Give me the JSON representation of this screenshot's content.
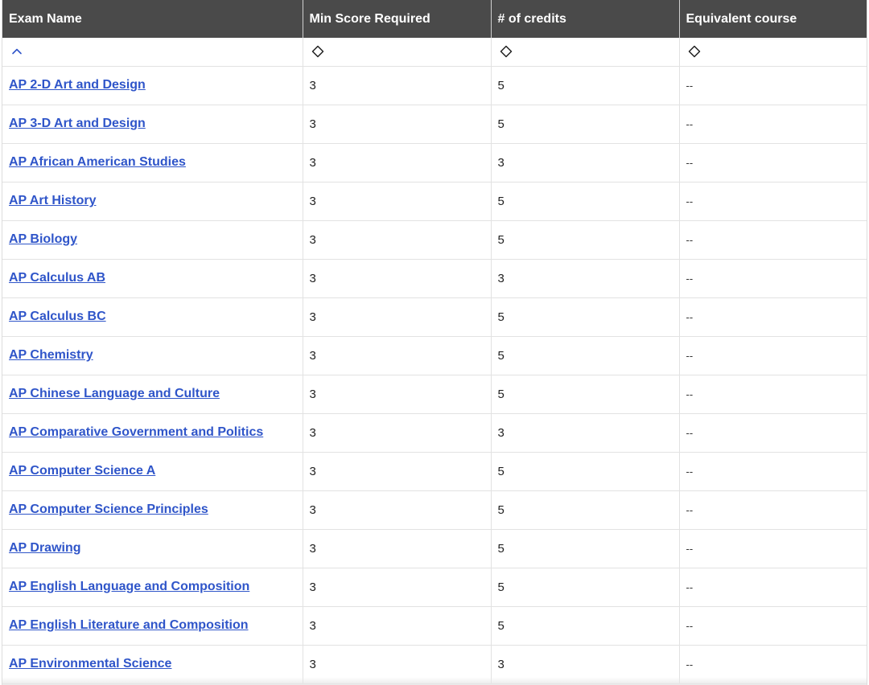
{
  "table": {
    "headers": [
      "Exam Name",
      "Min Score Required",
      "# of credits",
      "Equivalent course"
    ],
    "sort_icons": [
      "chevron-up-icon",
      "sort-diamond-icon",
      "sort-diamond-icon",
      "sort-diamond-icon"
    ],
    "link_color": "#2f55c9",
    "header_bg": "#4a4a4a",
    "rows": [
      {
        "exam": "AP 2-D Art and Design",
        "min_score": "3",
        "credits": "5",
        "equivalent": "--"
      },
      {
        "exam": "AP 3-D Art and Design",
        "min_score": "3",
        "credits": "5",
        "equivalent": "--"
      },
      {
        "exam": "AP African American Studies",
        "min_score": "3",
        "credits": "3",
        "equivalent": "--"
      },
      {
        "exam": "AP Art History",
        "min_score": "3",
        "credits": "5",
        "equivalent": "--"
      },
      {
        "exam": "AP Biology",
        "min_score": "3",
        "credits": "5",
        "equivalent": "--"
      },
      {
        "exam": "AP Calculus AB",
        "min_score": "3",
        "credits": "3",
        "equivalent": "--"
      },
      {
        "exam": "AP Calculus BC",
        "min_score": "3",
        "credits": "5",
        "equivalent": "--"
      },
      {
        "exam": "AP Chemistry",
        "min_score": "3",
        "credits": "5",
        "equivalent": "--"
      },
      {
        "exam": "AP Chinese Language and Culture",
        "min_score": "3",
        "credits": "5",
        "equivalent": "--"
      },
      {
        "exam": "AP Comparative Government and Politics",
        "min_score": "3",
        "credits": "3",
        "equivalent": "--"
      },
      {
        "exam": "AP Computer Science A",
        "min_score": "3",
        "credits": "5",
        "equivalent": "--"
      },
      {
        "exam": "AP Computer Science Principles",
        "min_score": "3",
        "credits": "5",
        "equivalent": "--"
      },
      {
        "exam": "AP Drawing",
        "min_score": "3",
        "credits": "5",
        "equivalent": "--"
      },
      {
        "exam": "AP English Language and Composition",
        "min_score": "3",
        "credits": "5",
        "equivalent": "--"
      },
      {
        "exam": "AP English Literature and Composition",
        "min_score": "3",
        "credits": "5",
        "equivalent": "--"
      },
      {
        "exam": "AP Environmental Science",
        "min_score": "3",
        "credits": "3",
        "equivalent": "--"
      }
    ]
  }
}
